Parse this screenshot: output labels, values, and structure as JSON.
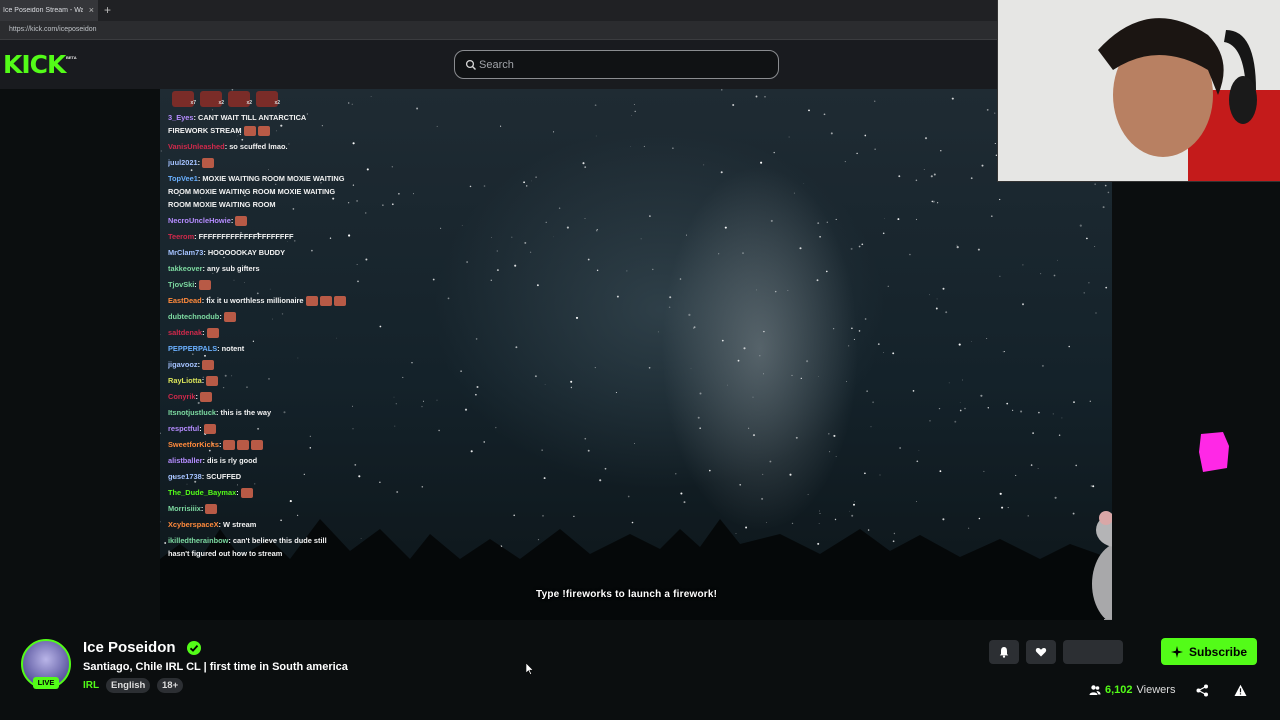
{
  "browser": {
    "tab_title": "Ice Poseidon Stream - Watch",
    "tab_close": "×",
    "new_tab": "+",
    "url": "https://kick.com/iceposeidon"
  },
  "header": {
    "logo": "KICK",
    "logo_badge": "BETA",
    "search_placeholder": "Search",
    "search_icon": "search-icon"
  },
  "colors": {
    "brand": "#53fc18",
    "background": "#0b0e0f",
    "header": "#191b1f"
  },
  "chat": {
    "badges": [
      {
        "count": "x7"
      },
      {
        "count": "x2"
      },
      {
        "count": "x2"
      },
      {
        "count": "x2"
      }
    ],
    "messages": [
      {
        "user": "3_Eyes",
        "text": ": CANT WAIT TILL ANTARCTICA FIREWORK STREAM",
        "color": "#b58cff",
        "emotes": 2
      },
      {
        "user": "VanisUnleashed",
        "text": ": so scuffed lmao.",
        "color": "#d0294b",
        "emotes": 0
      },
      {
        "user": "juul2021",
        "text": ":",
        "color": "#a4c2ff",
        "emotes": 1
      },
      {
        "user": "TopVee1",
        "text": ": MOXIE WAITING ROOM   MOXIE WAITING ROOM   MOXIE WAITING ROOM   MOXIE WAITING ROOM   MOXIE WAITING ROOM",
        "color": "#6ab0ff",
        "emotes": 0
      },
      {
        "user": "NecroUncleHowie",
        "text": ":",
        "color": "#b58cff",
        "emotes": 1
      },
      {
        "user": "Teerom",
        "text": ": FFFFFFFFFFFFFFFFFFFFF",
        "color": "#d0294b",
        "emotes": 0
      },
      {
        "user": "MrClam73",
        "text": ": HOOOOOKAY BUDDY",
        "color": "#a4c2ff",
        "emotes": 0
      },
      {
        "user": "takkeover",
        "text": ": any sub gifters",
        "color": "#7cd9a0",
        "emotes": 0
      },
      {
        "user": "TjovSki",
        "text": ":",
        "color": "#7cd9a0",
        "emotes": 1
      },
      {
        "user": "EastDead",
        "text": ": fix it u worthless millionaire",
        "color": "#ff8a3c",
        "emotes": 3
      },
      {
        "user": "dubtechnodub",
        "text": ":",
        "color": "#7cd9a0",
        "emotes": 1
      },
      {
        "user": "saltdenak",
        "text": ":",
        "color": "#d0294b",
        "emotes": 1
      },
      {
        "user": "PEPPERPALS",
        "text": ": notent",
        "color": "#6ab0ff",
        "emotes": 0
      },
      {
        "user": "jigavooz",
        "text": ":",
        "color": "#a4c2ff",
        "emotes": 1
      },
      {
        "user": "RayLiotta",
        "text": ":",
        "color": "#d9e35a",
        "emotes": 1
      },
      {
        "user": "Conyrik",
        "text": ":",
        "color": "#d0294b",
        "emotes": 1
      },
      {
        "user": "Itsnotjustluck",
        "text": ": this is the way",
        "color": "#7cd9a0",
        "emotes": 0
      },
      {
        "user": "respctful",
        "text": ":",
        "color": "#b58cff",
        "emotes": 1
      },
      {
        "user": "SweetforKicks",
        "text": ":",
        "color": "#ff8a3c",
        "emotes": 3
      },
      {
        "user": "alistballer",
        "text": ": dis is rly good",
        "color": "#b58cff",
        "emotes": 0
      },
      {
        "user": "guse1738",
        "text": ": SCUFFED",
        "color": "#a4c2ff",
        "emotes": 0
      },
      {
        "user": "The_Dude_Baymax",
        "text": ":",
        "color": "#53fc18",
        "emotes": 1
      },
      {
        "user": "Morrisiiix",
        "text": ":",
        "color": "#7cd9a0",
        "emotes": 1
      },
      {
        "user": "XcyberspaceX",
        "text": ": W stream",
        "color": "#ff8a3c",
        "emotes": 0
      },
      {
        "user": "ikilledtherainbow",
        "text": ": can't believe this dude still hasn't figured out how to stream",
        "color": "#7cd9a0",
        "emotes": 0
      }
    ]
  },
  "stream": {
    "overlay_text": "Type !fireworks to launch a firework!"
  },
  "channel": {
    "name": "Ice Poseidon",
    "live_label": "LIVE",
    "title": "Santiago, Chile IRL CL | first time in South america",
    "category": "IRL",
    "tags": [
      "English",
      "18+"
    ],
    "subscribe_label": "Subscribe",
    "viewer_count": "6,102",
    "viewer_label": "Viewers"
  }
}
